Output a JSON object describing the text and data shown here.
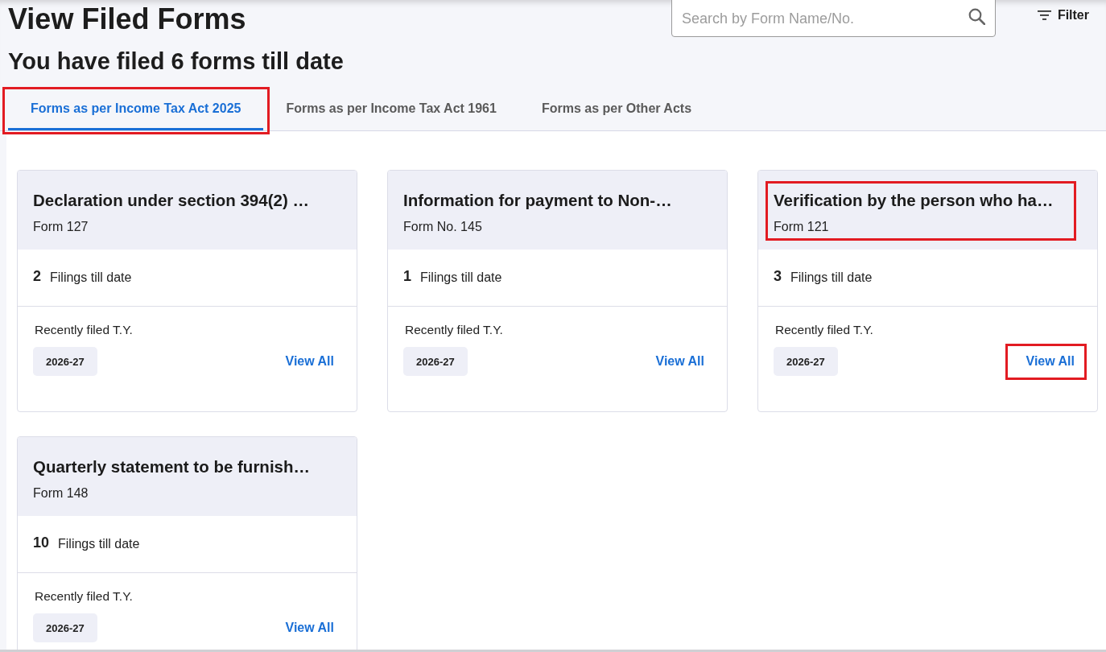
{
  "page": {
    "title": "View Filed Forms",
    "subtitle": "You have filed 6 forms till date"
  },
  "search": {
    "placeholder": "Search by Form Name/No."
  },
  "filter_button": {
    "label": "Filter"
  },
  "tabs": [
    {
      "label": "Forms as per Income Tax Act 2025",
      "selected": true,
      "highlighted": true
    },
    {
      "label": "Forms as per Income Tax Act 1961",
      "selected": false,
      "highlighted": false
    },
    {
      "label": "Forms as per Other Acts",
      "selected": false,
      "highlighted": false
    }
  ],
  "cards": [
    {
      "title": "Declaration under section 394(2) …",
      "form_no": "Form 127",
      "filings_count": "2",
      "filings_label": "Filings till date",
      "recent_label": "Recently filed T.Y.",
      "recent_year": "2026-27",
      "view_all": "View All",
      "header_highlighted": false,
      "view_all_highlighted": false
    },
    {
      "title": "Information for payment to Non-…",
      "form_no": "Form No. 145",
      "filings_count": "1",
      "filings_label": "Filings till date",
      "recent_label": "Recently filed T.Y.",
      "recent_year": "2026-27",
      "view_all": "View All",
      "header_highlighted": false,
      "view_all_highlighted": false
    },
    {
      "title": "Verification by the person who ha…",
      "form_no": "Form 121",
      "filings_count": "3",
      "filings_label": "Filings till date",
      "recent_label": "Recently filed T.Y.",
      "recent_year": "2026-27",
      "view_all": "View All",
      "header_highlighted": true,
      "view_all_highlighted": true
    },
    {
      "title": "Quarterly statement to be furnish…",
      "form_no": "Form 148",
      "filings_count": "10",
      "filings_label": "Filings till date",
      "recent_label": "Recently filed T.Y.",
      "recent_year": "2026-27",
      "view_all": "View All",
      "header_highlighted": false,
      "view_all_highlighted": false
    }
  ]
}
